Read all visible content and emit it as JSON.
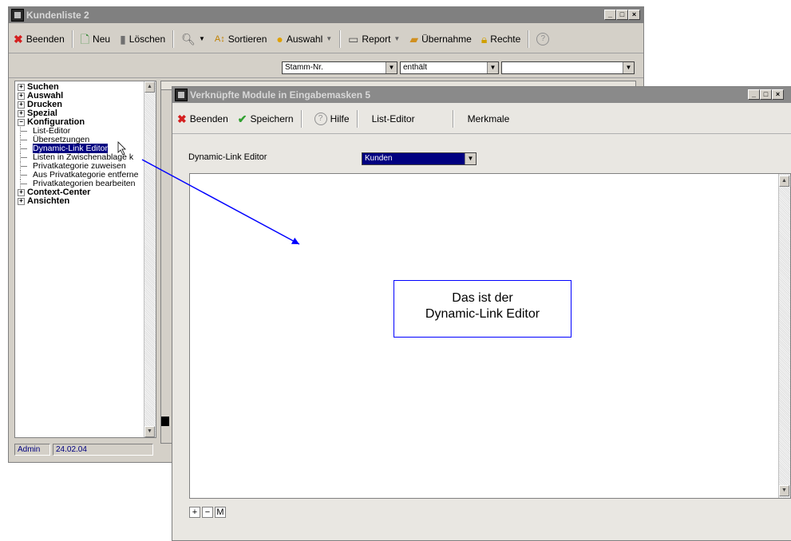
{
  "back_window": {
    "title": "Kundenliste 2",
    "window_buttons": [
      "_",
      "□",
      "×"
    ],
    "toolbar": {
      "beenden": "Beenden",
      "neu": "Neu",
      "loeschen": "Löschen",
      "sortieren": "Sortieren",
      "auswahl": "Auswahl",
      "report": "Report",
      "uebernahme": "Übernahme",
      "rechte": "Rechte"
    },
    "filter": {
      "field": "Stamm-Nr.",
      "operator": "enthält",
      "value": ""
    },
    "tree": [
      {
        "label": "Suchen",
        "level": 0,
        "expander": "+"
      },
      {
        "label": "Auswahl",
        "level": 0,
        "expander": "+"
      },
      {
        "label": "Drucken",
        "level": 0,
        "expander": "+"
      },
      {
        "label": "Spezial",
        "level": 0,
        "expander": "+"
      },
      {
        "label": "Konfiguration",
        "level": 0,
        "expander": "−"
      },
      {
        "label": "List-Editor",
        "level": 1
      },
      {
        "label": "Übersetzungen",
        "level": 1
      },
      {
        "label": "Dynamic-Link Editor",
        "level": 1,
        "selected": true
      },
      {
        "label": "Listen in Zwischenablage k",
        "level": 1
      },
      {
        "label": "Privatkategorie zuweisen",
        "level": 1
      },
      {
        "label": "Aus Privatkategorie entferne",
        "level": 1
      },
      {
        "label": "Privatkategorien bearbeiten",
        "level": 1
      },
      {
        "label": "Context-Center",
        "level": 0,
        "expander": "+"
      },
      {
        "label": "Ansichten",
        "level": 0,
        "expander": "+"
      }
    ],
    "status": {
      "user": "Admin",
      "date": "24.02.04"
    }
  },
  "front_window": {
    "title": "Verknüpfte Module in Eingabemasken 5",
    "window_buttons": [
      "_",
      "□",
      "×"
    ],
    "toolbar": {
      "beenden": "Beenden",
      "speichern": "Speichern",
      "hilfe": "Hilfe",
      "list_editor": "List-Editor",
      "merkmale": "Merkmale"
    },
    "editor_label": "Dynamic-Link Editor",
    "module_select": "Kunden",
    "bottom_buttons": [
      "+",
      "−",
      "M"
    ]
  },
  "callout": {
    "line1": "Das ist der",
    "line2": "Dynamic-Link Editor"
  },
  "colors": {
    "selection": "#000080",
    "arrow": "#0000ff",
    "callout_border": "#0000ff"
  }
}
